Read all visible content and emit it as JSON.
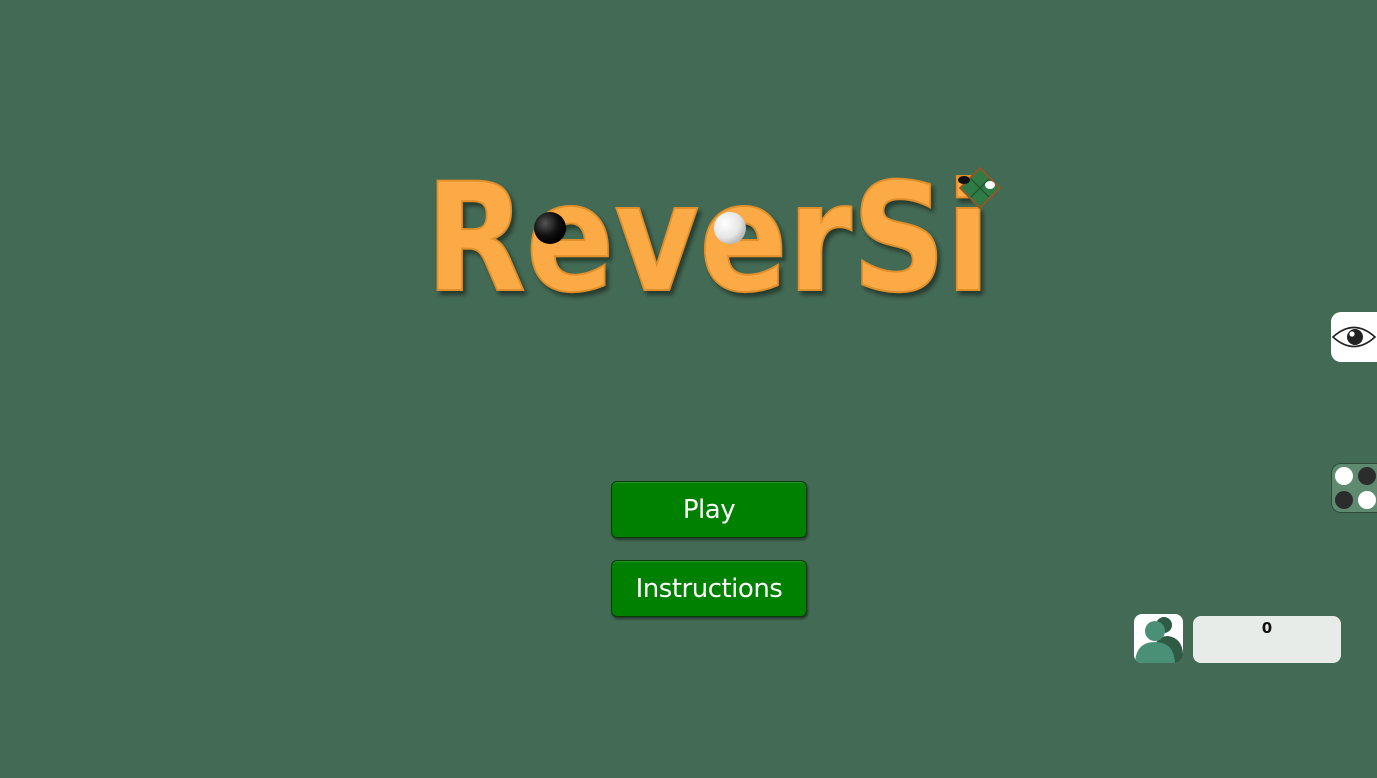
{
  "logo": {
    "text": "ReverSi"
  },
  "menu": {
    "play_label": "Play",
    "instructions_label": "Instructions"
  },
  "side_tabs": {
    "eye_icon": "eye-icon",
    "board_icon": "mini-board-icon"
  },
  "player": {
    "avatar_icon": "user-avatar-icon",
    "score": "0"
  },
  "colors": {
    "background": "#436a54",
    "logo": "#fbaa44",
    "button": "#008000",
    "button_text": "#ffffff"
  }
}
